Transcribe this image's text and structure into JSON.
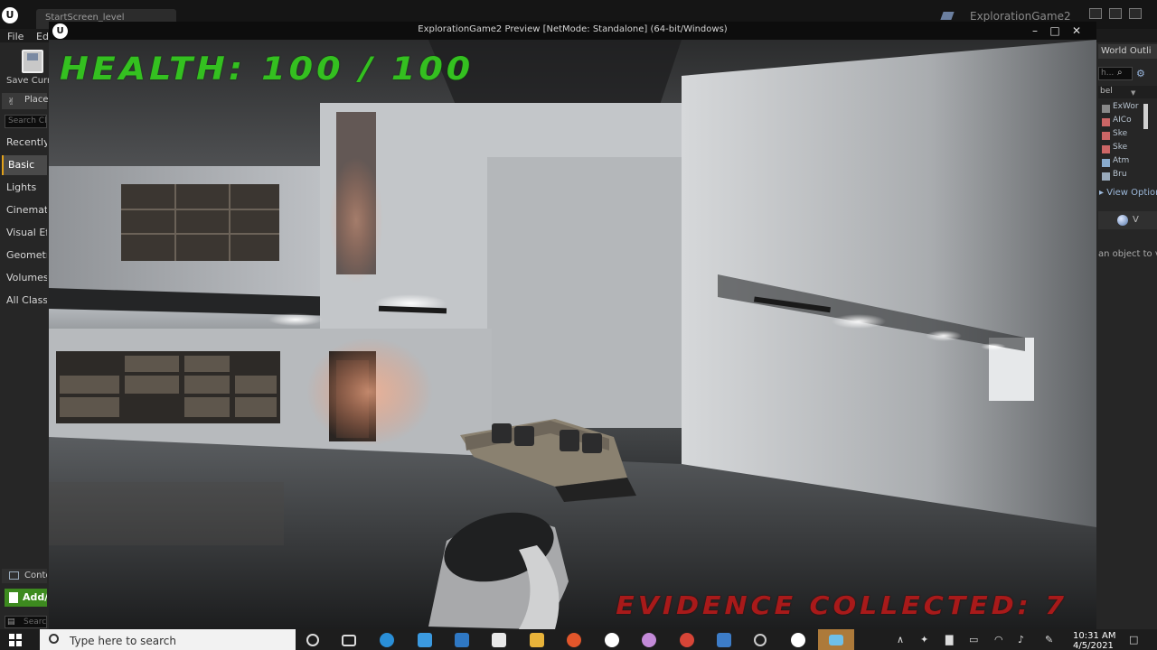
{
  "editor": {
    "level_tab": "StartScreen_level",
    "window_title": "ExplorationGame2",
    "menu": {
      "file": "File",
      "edit": "Ed"
    },
    "save_label": "Save Curre",
    "place_tab": "Place",
    "search_classes_placeholder": "Search Cl",
    "place_categories": [
      "Recently",
      "Basic",
      "Lights",
      "Cinemati",
      "Visual Eff",
      "Geometry",
      "Volumes",
      "All Classe"
    ],
    "active_category": "Basic",
    "content_tab": "Conte",
    "add_new": "Add/",
    "content_search": "Searc"
  },
  "outliner": {
    "tab": "World Outli",
    "search_placeholder": "h...",
    "column_label": "bel",
    "rows": [
      "ExWor",
      "AICo",
      "Ske",
      "Ske",
      "Atm",
      "Bru"
    ],
    "view_options": "▸ View Options",
    "details_label": "V",
    "select_hint": "an object to v"
  },
  "game": {
    "title": "ExplorationGame2 Preview [NetMode: Standalone]  (64-bit/Windows)",
    "hud": {
      "health": "HEALTH: 100 / 100",
      "evidence": "EVIDENCE COLLECTED: 7"
    }
  },
  "taskbar": {
    "search_placeholder": "Type here to search",
    "time": "10:31 AM",
    "date": "4/5/2021"
  },
  "colors": {
    "health_text": "#34c020",
    "evidence_text": "#a81a1a",
    "active_category_accent": "#e3a21a",
    "add_button": "#3d8a1f"
  }
}
